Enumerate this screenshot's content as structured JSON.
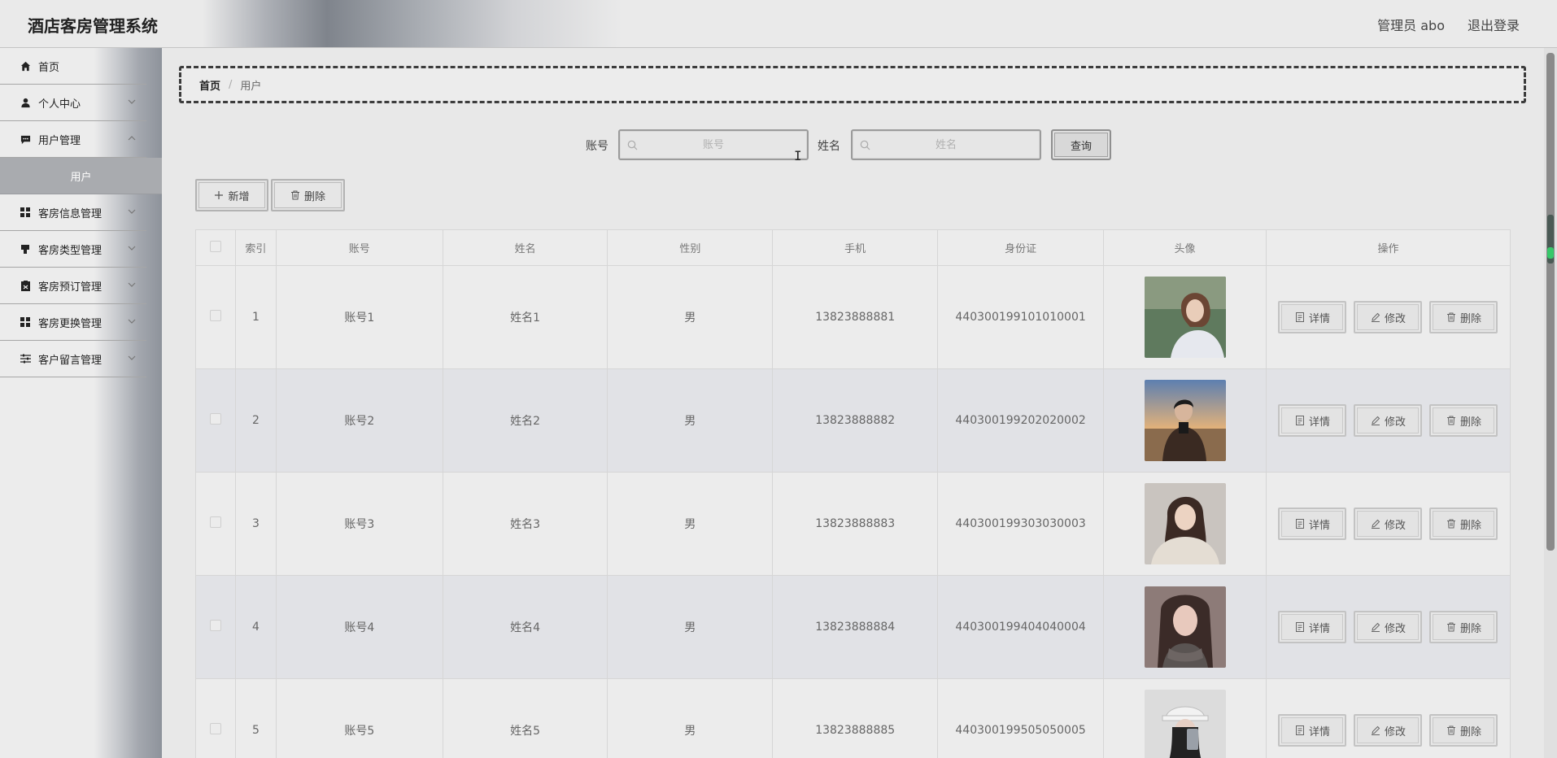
{
  "app": {
    "title": "酒店客房管理系统"
  },
  "header": {
    "user": "管理员 abo",
    "logout": "退出登录"
  },
  "sidebar": {
    "items": [
      {
        "label": "首页",
        "icon": "home-icon",
        "expandable": false
      },
      {
        "label": "个人中心",
        "icon": "user-icon",
        "expandable": true
      },
      {
        "label": "用户管理",
        "icon": "chat-icon",
        "expandable": true
      },
      {
        "label": "客房信息管理",
        "icon": "grid-icon",
        "expandable": true
      },
      {
        "label": "客房类型管理",
        "icon": "cup-icon",
        "expandable": true
      },
      {
        "label": "客房预订管理",
        "icon": "clipboard-icon",
        "expandable": true
      },
      {
        "label": "客房更换管理",
        "icon": "grid-icon",
        "expandable": true
      },
      {
        "label": "客户留言管理",
        "icon": "sliders-icon",
        "expandable": true
      }
    ],
    "active_sub": "用户"
  },
  "breadcrumb": {
    "home": "首页",
    "separator": "/",
    "current": "用户"
  },
  "search": {
    "account_label": "账号",
    "account_placeholder": "账号",
    "account_value": "",
    "name_label": "姓名",
    "name_placeholder": "姓名",
    "name_value": "",
    "query_button": "查询"
  },
  "actions": {
    "add": "新增",
    "delete": "删除"
  },
  "table": {
    "columns": [
      "索引",
      "账号",
      "姓名",
      "性别",
      "手机",
      "身份证",
      "头像",
      "操作"
    ],
    "rows": [
      {
        "index": "1",
        "account": "账号1",
        "name": "姓名1",
        "gender": "男",
        "phone": "13823888881",
        "id_card": "440300199101010001"
      },
      {
        "index": "2",
        "account": "账号2",
        "name": "姓名2",
        "gender": "男",
        "phone": "13823888882",
        "id_card": "440300199202020002"
      },
      {
        "index": "3",
        "account": "账号3",
        "name": "姓名3",
        "gender": "男",
        "phone": "13823888883",
        "id_card": "440300199303030003"
      },
      {
        "index": "4",
        "account": "账号4",
        "name": "姓名4",
        "gender": "男",
        "phone": "13823888884",
        "id_card": "440300199404040004"
      },
      {
        "index": "5",
        "account": "账号5",
        "name": "姓名5",
        "gender": "男",
        "phone": "13823888885",
        "id_card": "440300199505050005"
      }
    ],
    "row_actions": {
      "detail": "详情",
      "edit": "修改",
      "delete": "删除"
    }
  }
}
